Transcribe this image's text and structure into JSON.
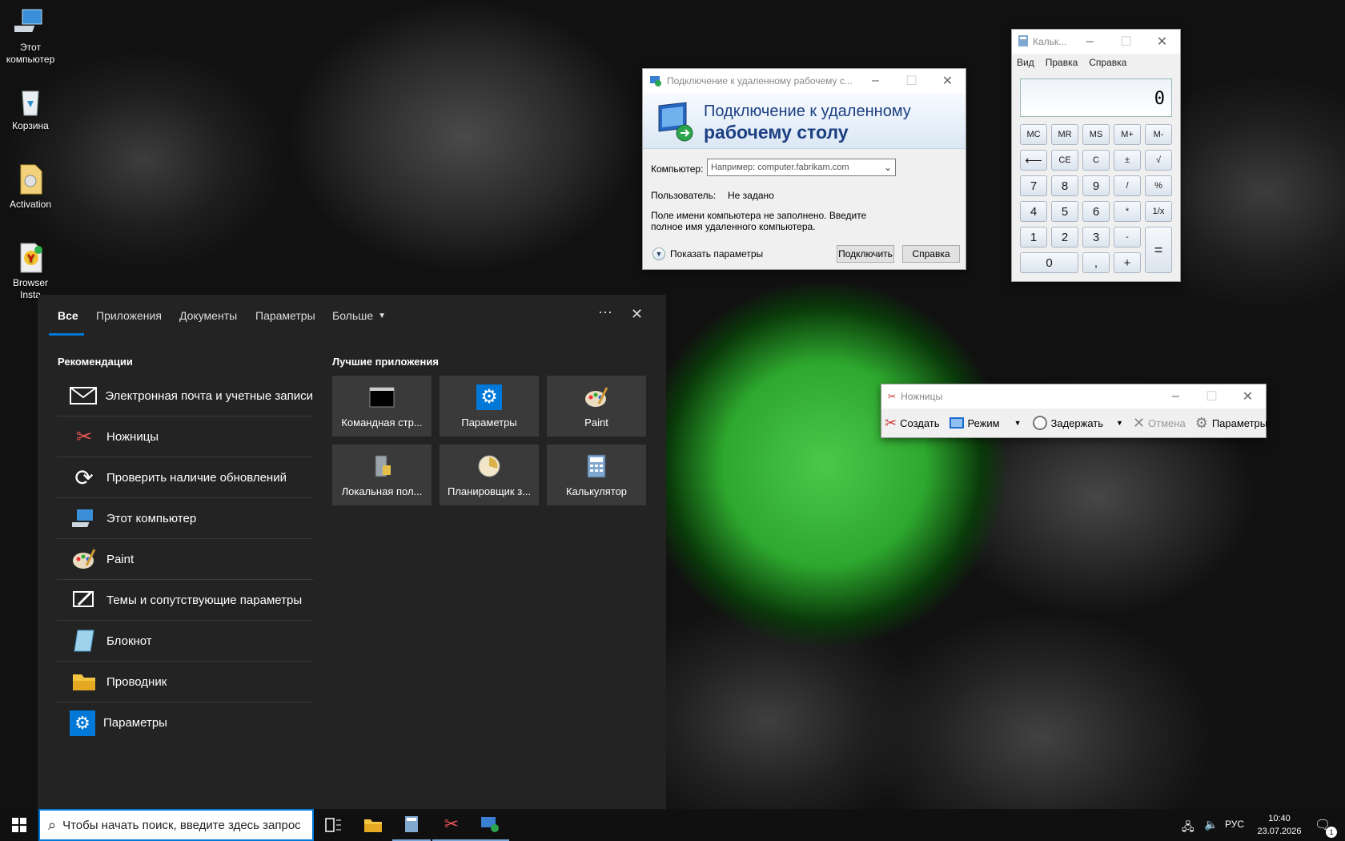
{
  "desktop": {
    "icons": [
      {
        "label": "Этот компьютер",
        "icon": "this-pc-icon"
      },
      {
        "label": "Корзина",
        "icon": "recycle-bin-icon"
      },
      {
        "label": "Activation",
        "icon": "file-icon"
      },
      {
        "label": "Browser Insta",
        "icon": "yandex-browser-icon"
      }
    ]
  },
  "rdp": {
    "title": "Подключение к удаленному рабочему с...",
    "header_line1": "Подключение к удаленному",
    "header_line2": "рабочему столу",
    "computer_label": "Компьютер:",
    "computer_placeholder": "Например: computer.fabrikam.com",
    "user_label": "Пользователь:",
    "user_value": "Не задано",
    "message": "Поле имени компьютера не заполнено. Введите полное имя удаленного компьютера.",
    "show_options": "Показать параметры",
    "connect_btn": "Подключить",
    "help_btn": "Справка"
  },
  "calc": {
    "title": "Кальк...",
    "menu": [
      "Вид",
      "Правка",
      "Справка"
    ],
    "display": "0",
    "mem_keys": [
      "MC",
      "MR",
      "MS",
      "M+",
      "M-"
    ],
    "keys": {
      "back": "⟵",
      "ce": "CE",
      "c": "C",
      "pm": "±",
      "sqrt": "√",
      "k7": "7",
      "k8": "8",
      "k9": "9",
      "div": "/",
      "pct": "%",
      "k4": "4",
      "k5": "5",
      "k6": "6",
      "mul": "*",
      "inv": "1/x",
      "k1": "1",
      "k2": "2",
      "k3": "3",
      "sub": "-",
      "eq": "=",
      "k0": "0",
      "dot": ",",
      "add": "+"
    }
  },
  "snip": {
    "title": "Ножницы",
    "create": "Создать",
    "mode": "Режим",
    "delay": "Задержать",
    "cancel": "Отмена",
    "options": "Параметры"
  },
  "search": {
    "tabs": [
      "Все",
      "Приложения",
      "Документы",
      "Параметры",
      "Больше"
    ],
    "rec_heading": "Рекомендации",
    "top_heading": "Лучшие приложения",
    "recommendations": [
      {
        "label": "Электронная почта и учетные записи",
        "icon": "mail-icon"
      },
      {
        "label": "Ножницы",
        "icon": "snipping-tool-icon"
      },
      {
        "label": "Проверить наличие обновлений",
        "icon": "sync-icon"
      },
      {
        "label": "Этот компьютер",
        "icon": "this-pc-icon"
      },
      {
        "label": "Paint",
        "icon": "paint-icon"
      },
      {
        "label": "Темы и сопутствующие параметры",
        "icon": "themes-icon"
      },
      {
        "label": "Блокнот",
        "icon": "notepad-icon"
      },
      {
        "label": "Проводник",
        "icon": "folder-icon"
      },
      {
        "label": "Параметры",
        "icon": "gear-icon"
      }
    ],
    "top_apps": [
      {
        "label": "Командная стр...",
        "icon": "cmd-icon"
      },
      {
        "label": "Параметры",
        "icon": "gear-icon"
      },
      {
        "label": "Paint",
        "icon": "paint-icon"
      },
      {
        "label": "Локальная пол...",
        "icon": "policy-icon"
      },
      {
        "label": "Планировщик з...",
        "icon": "scheduler-icon"
      },
      {
        "label": "Калькулятор",
        "icon": "calculator-icon"
      }
    ]
  },
  "taskbar": {
    "search_placeholder": "Чтобы начать поиск, введите здесь запрос",
    "lang": "РУС",
    "time": "10:40",
    "date": "23.07.2026",
    "notification_count": "1"
  },
  "colors": {
    "accent": "#0078d7",
    "green_umbrella": "#3cc83c",
    "start_dark": "#232323"
  }
}
